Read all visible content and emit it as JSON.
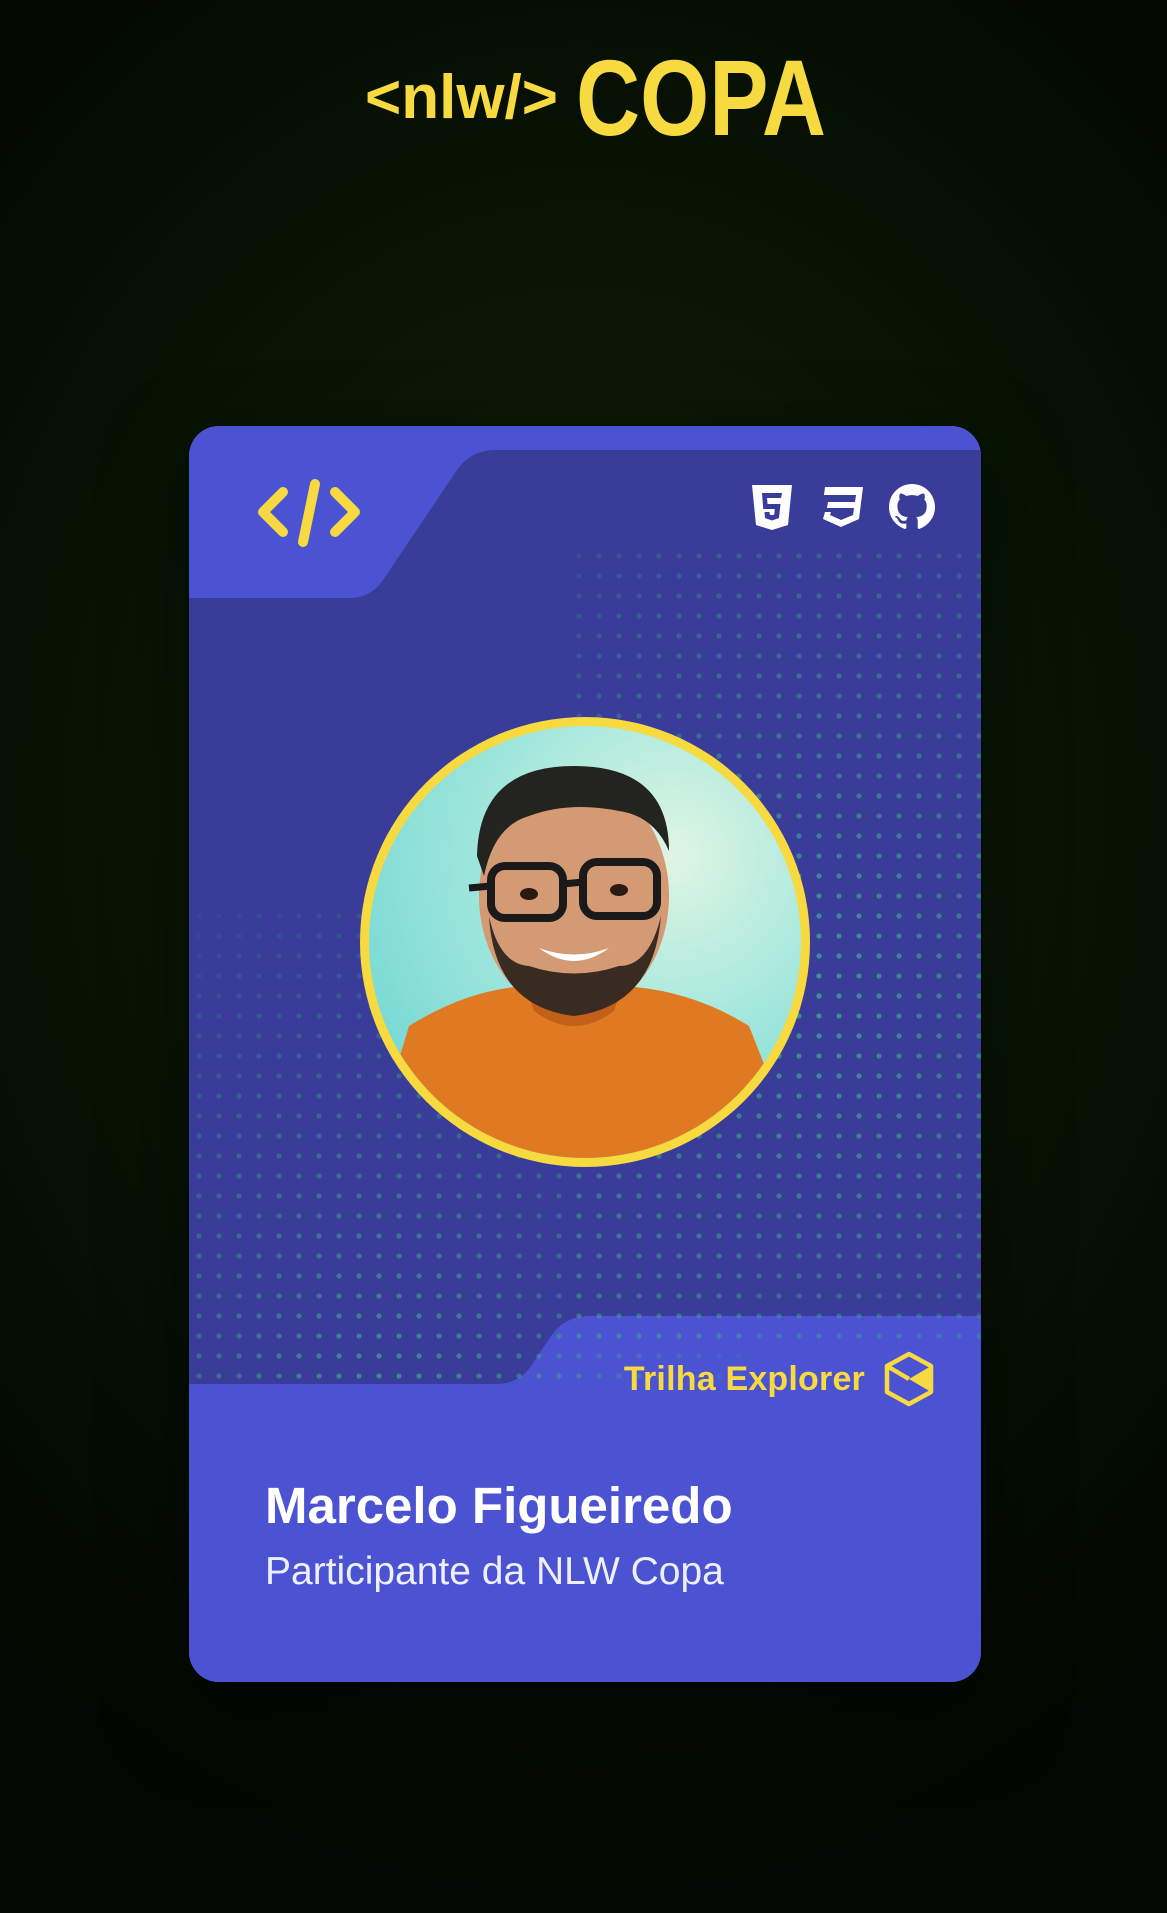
{
  "logo": {
    "tag": "<nlw/>",
    "name": "COPA",
    "color": "#f7d940"
  },
  "card": {
    "code_icon": "code-brackets-icon",
    "tech_icons": [
      "html5-icon",
      "css3-icon",
      "github-icon"
    ],
    "trail": {
      "label": "Trilha Explorer",
      "icon": "explorer-cube-icon"
    },
    "user": {
      "name": "Marcelo Figueiredo",
      "role": "Participante da NLW Copa"
    },
    "colors": {
      "primary": "#4c53d2",
      "dark": "#393c99",
      "accent": "#f7d940",
      "dots": "#3aa58a"
    }
  }
}
